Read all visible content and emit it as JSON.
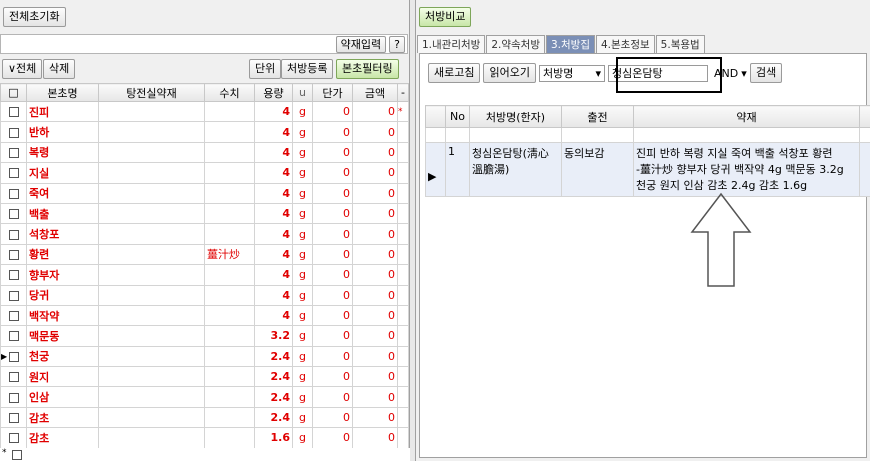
{
  "left": {
    "reset_button": "전체초기화",
    "herb_input_button": "약재입력",
    "help_button": "?",
    "all_button": "∨전체",
    "delete_button": "삭제",
    "unit_button": "단위",
    "register_button": "처방등록",
    "filter_button": "본초필터링",
    "columns": [
      "□",
      "본초명",
      "탕전실약재",
      "수치",
      "용량",
      "u",
      "단가",
      "금액",
      "-"
    ],
    "rows": [
      {
        "name": "진피",
        "proc": "",
        "dose": "4",
        "unit": "g",
        "price": "0",
        "amount": "0",
        "mark": "*"
      },
      {
        "name": "반하",
        "proc": "",
        "dose": "4",
        "unit": "g",
        "price": "0",
        "amount": "0",
        "mark": ""
      },
      {
        "name": "복령",
        "proc": "",
        "dose": "4",
        "unit": "g",
        "price": "0",
        "amount": "0",
        "mark": ""
      },
      {
        "name": "지실",
        "proc": "",
        "dose": "4",
        "unit": "g",
        "price": "0",
        "amount": "0",
        "mark": ""
      },
      {
        "name": "죽여",
        "proc": "",
        "dose": "4",
        "unit": "g",
        "price": "0",
        "amount": "0",
        "mark": ""
      },
      {
        "name": "백출",
        "proc": "",
        "dose": "4",
        "unit": "g",
        "price": "0",
        "amount": "0",
        "mark": ""
      },
      {
        "name": "석창포",
        "proc": "",
        "dose": "4",
        "unit": "g",
        "price": "0",
        "amount": "0",
        "mark": ""
      },
      {
        "name": "황련",
        "proc": "薑汁炒",
        "dose": "4",
        "unit": "g",
        "price": "0",
        "amount": "0",
        "mark": ""
      },
      {
        "name": "향부자",
        "proc": "",
        "dose": "4",
        "unit": "g",
        "price": "0",
        "amount": "0",
        "mark": ""
      },
      {
        "name": "당귀",
        "proc": "",
        "dose": "4",
        "unit": "g",
        "price": "0",
        "amount": "0",
        "mark": ""
      },
      {
        "name": "백작약",
        "proc": "",
        "dose": "4",
        "unit": "g",
        "price": "0",
        "amount": "0",
        "mark": ""
      },
      {
        "name": "맥문동",
        "proc": "",
        "dose": "3.2",
        "unit": "g",
        "price": "0",
        "amount": "0",
        "mark": ""
      },
      {
        "name": "천궁",
        "proc": "",
        "dose": "2.4",
        "unit": "g",
        "price": "0",
        "amount": "0",
        "mark": ""
      },
      {
        "name": "원지",
        "proc": "",
        "dose": "2.4",
        "unit": "g",
        "price": "0",
        "amount": "0",
        "mark": ""
      },
      {
        "name": "인삼",
        "proc": "",
        "dose": "2.4",
        "unit": "g",
        "price": "0",
        "amount": "0",
        "mark": ""
      },
      {
        "name": "감초",
        "proc": "",
        "dose": "2.4",
        "unit": "g",
        "price": "0",
        "amount": "0",
        "mark": ""
      },
      {
        "name": "감초",
        "proc": "",
        "dose": "1.6",
        "unit": "g",
        "price": "0",
        "amount": "0",
        "mark": ""
      }
    ],
    "new_row_marker": "*"
  },
  "right": {
    "compare_button": "처방비교",
    "tabs": [
      "1.내관리처방",
      "2.약속처방",
      "3.처방집",
      "4.본초정보",
      "5.복용법"
    ],
    "refresh_button": "새로고침",
    "load_button": "읽어오기",
    "field_select": "처방명",
    "search_value": "청심온담탕",
    "logic_select": "AND",
    "search_button": "검색",
    "columns": [
      "No",
      "처방명(한자)",
      "출전",
      "약재"
    ],
    "result": {
      "no": "1",
      "name_line1": "청심온담탕(淸心",
      "name_line2": "溫膽湯)",
      "source": "동의보감",
      "herbs_line1": "진피 반하 복령 지실 죽여 백출 석창포 황련",
      "herbs_line2": "-薑汁炒 향부자 당귀 백작약 4g 맥문동  3.2g",
      "herbs_line3": "천궁 원지 인삼 감초 2.4g 감초  1.6g"
    }
  },
  "colors": {
    "accent_red": "#e00000",
    "tab_active": "#7b8fb6"
  }
}
